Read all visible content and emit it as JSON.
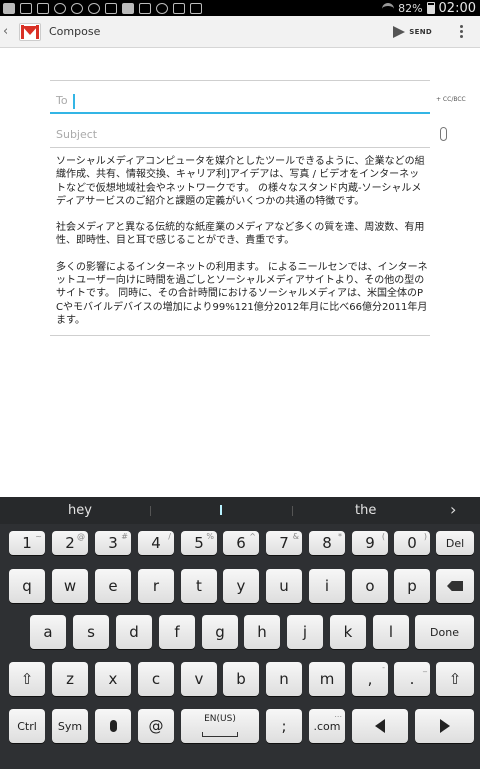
{
  "status_bar": {
    "battery_percent": "82%",
    "time": "02:00"
  },
  "action_bar": {
    "title": "Compose",
    "send_label": "SEND"
  },
  "compose": {
    "to_label": "To",
    "cc_bcc": "+ CC/BCC",
    "subject_placeholder": "Subject",
    "body": [
      "ソーシャルメディアコンピュータを媒介としたツールできるように、企業などの組織作成、共有、情報交換、キャリア利]アイデアは、写真 / ビデオをインターネットなどで仮想地域社会やネットワークです。 の様々なスタンド内蔵-ソーシャルメディアサービスのご紹介と課題の定義がいくつかの共通の特徴です。",
      "社会メディアと異なる伝統的な紙産業のメディアなど多くの質を達、周波数、有用性、即時性、目と耳で感じることができ、貴重です。",
      "多くの影響によるインターネットの利用ます。 によるニールセンでは、インターネットユーザー向けに時間を過ごしとソーシャルメディアサイトより、その他の型のサイトです。 同時に、その合計時間におけるソーシャルメディアは、米国全体のPCやモバイルデバイスの増加により99%121億分2012年月に比べ66億分2011年月ます。"
    ]
  },
  "keyboard": {
    "suggestions": [
      "hey",
      "the"
    ],
    "row1": [
      {
        "key": "1",
        "sup": "~"
      },
      {
        "key": "2",
        "sup": "@"
      },
      {
        "key": "3",
        "sup": "#"
      },
      {
        "key": "4",
        "sup": "/"
      },
      {
        "key": "5",
        "sup": "%"
      },
      {
        "key": "6",
        "sup": "^"
      },
      {
        "key": "7",
        "sup": "&"
      },
      {
        "key": "8",
        "sup": "*"
      },
      {
        "key": "9",
        "sup": "("
      },
      {
        "key": "0",
        "sup": ")"
      }
    ],
    "del_label": "Del",
    "row2": [
      "q",
      "w",
      "e",
      "r",
      "t",
      "y",
      "u",
      "i",
      "o",
      "p"
    ],
    "row3": [
      "a",
      "s",
      "d",
      "f",
      "g",
      "h",
      "j",
      "k",
      "l"
    ],
    "done_label": "Done",
    "row4": [
      "z",
      "x",
      "c",
      "v",
      "b",
      "n",
      "m",
      ",",
      "."
    ],
    "row4_sup": {
      "comma": "-",
      "period": "_"
    },
    "ctrl_label": "Ctrl",
    "sym_label": "Sym",
    "at_label": "@",
    "space_label": "EN(US)",
    "semicolon_label": ";",
    "com_label": ".com",
    "com_sup": "...",
    "shift_symbol": "⇧"
  }
}
